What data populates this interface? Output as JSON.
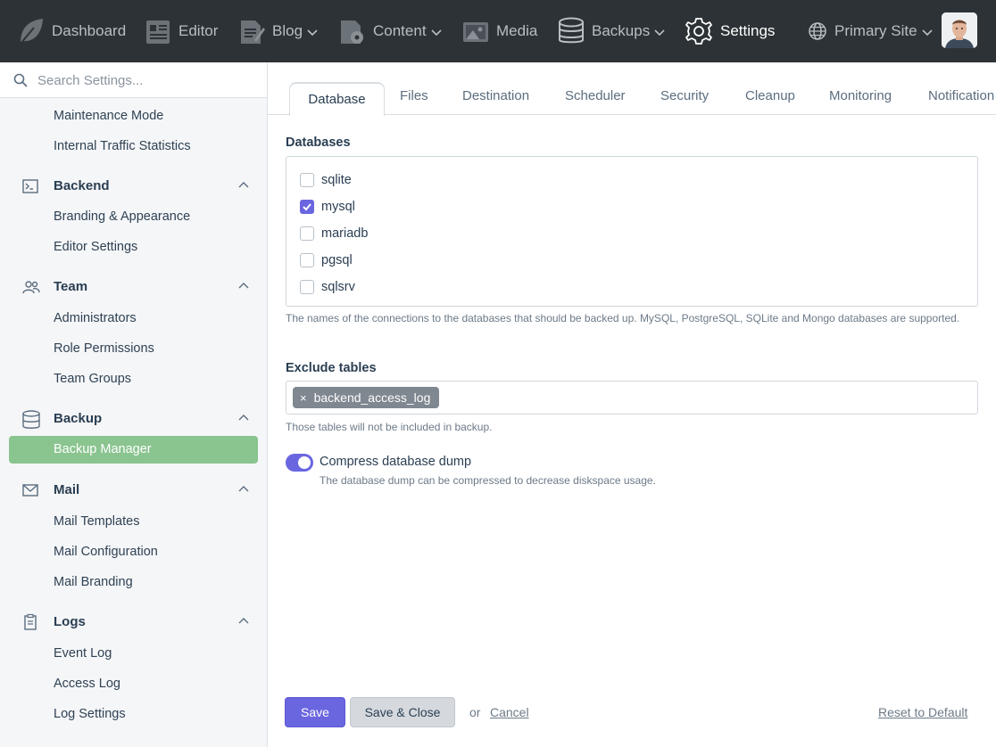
{
  "nav": {
    "items": [
      {
        "label": "Dashboard",
        "icon": "leaf-icon"
      },
      {
        "label": "Editor",
        "icon": "editor-icon"
      },
      {
        "label": "Blog",
        "icon": "blog-icon",
        "dropdown": true
      },
      {
        "label": "Content",
        "icon": "content-icon",
        "dropdown": true
      },
      {
        "label": "Media",
        "icon": "media-icon"
      },
      {
        "label": "Backups",
        "icon": "database-icon",
        "dropdown": true
      },
      {
        "label": "Settings",
        "icon": "gear-icon",
        "active": true
      },
      {
        "label": "Primary Site",
        "icon": "globe-icon",
        "dropdown": true
      }
    ],
    "avatar": "user-avatar"
  },
  "sidebar": {
    "search_placeholder": "Search Settings...",
    "top_links": [
      "Maintenance Mode",
      "Internal Traffic Statistics"
    ],
    "groups": [
      {
        "title": "Backend",
        "icon": "terminal-icon",
        "items": [
          "Branding & Appearance",
          "Editor Settings"
        ]
      },
      {
        "title": "Team",
        "icon": "team-icon",
        "items": [
          "Administrators",
          "Role Permissions",
          "Team Groups"
        ]
      },
      {
        "title": "Backup",
        "icon": "database-icon",
        "items": [
          "Backup Manager"
        ],
        "active_item": "Backup Manager"
      },
      {
        "title": "Mail",
        "icon": "mail-icon",
        "items": [
          "Mail Templates",
          "Mail Configuration",
          "Mail Branding"
        ]
      },
      {
        "title": "Logs",
        "icon": "clipboard-icon",
        "items": [
          "Event Log",
          "Access Log",
          "Log Settings"
        ]
      }
    ]
  },
  "tabs": [
    "Database",
    "Files",
    "Destination",
    "Scheduler",
    "Security",
    "Cleanup",
    "Monitoring",
    "Notification"
  ],
  "active_tab": "Database",
  "form": {
    "databases_label": "Databases",
    "databases": [
      {
        "name": "sqlite",
        "checked": false
      },
      {
        "name": "mysql",
        "checked": true
      },
      {
        "name": "mariadb",
        "checked": false
      },
      {
        "name": "pgsql",
        "checked": false
      },
      {
        "name": "sqlsrv",
        "checked": false
      }
    ],
    "databases_help": "The names of the connections to the databases that should be backed up. MySQL, PostgreSQL, SQLite and Mongo databases are supported.",
    "exclude_label": "Exclude tables",
    "exclude_tags": [
      "backend_access_log"
    ],
    "exclude_remove": "×",
    "exclude_help": "Those tables will not be included in backup.",
    "compress_label": "Compress database dump",
    "compress_on": true,
    "compress_help": "The database dump can be compressed to decrease diskspace usage."
  },
  "actions": {
    "save": "Save",
    "save_close": "Save & Close",
    "or": "or",
    "cancel": "Cancel",
    "reset": "Reset to Default"
  },
  "colors": {
    "topbar": "#2d3236",
    "accent": "#6a66e0",
    "active_sidebar": "#8ac48f"
  }
}
